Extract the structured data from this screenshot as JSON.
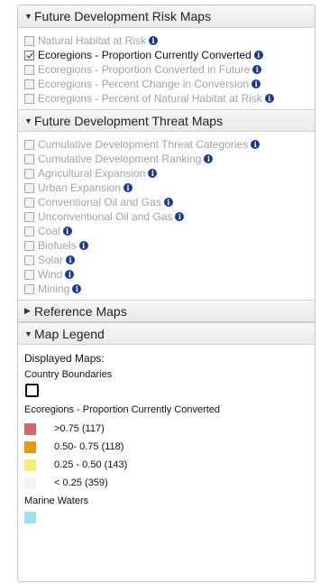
{
  "sections": {
    "risk": {
      "title": "Future Development Risk Maps",
      "items": [
        {
          "label": "Natural Habitat at Risk",
          "checked": false,
          "active": false,
          "info": true
        },
        {
          "label": "Ecoregions - Proportion Currently Converted",
          "checked": true,
          "active": true,
          "info": true
        },
        {
          "label": "Ecoregions - Proportion Converted in Future",
          "checked": false,
          "active": false,
          "info": true
        },
        {
          "label": "Ecoregions - Percent Change in Conversion",
          "checked": false,
          "active": false,
          "info": true
        },
        {
          "label": "Ecoregions - Percent of Natural Habitat at Risk",
          "checked": false,
          "active": false,
          "info": true
        }
      ]
    },
    "threat": {
      "title": "Future Development Threat Maps",
      "items": [
        {
          "label": "Cumulative Development Threat Categories",
          "checked": false,
          "active": false,
          "info": true
        },
        {
          "label": "Cumulative Development Ranking",
          "checked": false,
          "active": false,
          "info": true
        },
        {
          "label": "Agricultural Expansion",
          "checked": false,
          "active": false,
          "info": true
        },
        {
          "label": "Urban Expansion",
          "checked": false,
          "active": false,
          "info": true
        },
        {
          "label": "Conventional Oil and Gas",
          "checked": false,
          "active": false,
          "info": true
        },
        {
          "label": "Unconventional Oil and Gas",
          "checked": false,
          "active": false,
          "info": true
        },
        {
          "label": "Coal",
          "checked": false,
          "active": false,
          "info": true
        },
        {
          "label": "Biofuels",
          "checked": false,
          "active": false,
          "info": true
        },
        {
          "label": "Solar",
          "checked": false,
          "active": false,
          "info": true
        },
        {
          "label": "Wind",
          "checked": false,
          "active": false,
          "info": true
        },
        {
          "label": "Mining",
          "checked": false,
          "active": false,
          "info": true
        }
      ]
    },
    "reference": {
      "title": "Reference Maps"
    },
    "legend": {
      "title": "Map Legend"
    }
  },
  "legend": {
    "displayed_label": "Displayed Maps:",
    "country_boundaries": "Country Boundaries",
    "ecoregions_title": "Ecoregions - Proportion Currently Converted",
    "classes": [
      {
        "label": ">0.75 (117)",
        "color": "#d9656b"
      },
      {
        "label": "0.50- 0.75 (118)",
        "color": "#e59a0f"
      },
      {
        "label": "0.25 - 0.50 (143)",
        "color": "#f3f07a"
      },
      {
        "label": "< 0.25 (359)",
        "color": "#f4f4f6"
      }
    ],
    "marine_waters": "Marine Waters",
    "marine_color": "#9fe0ee"
  },
  "icons": {
    "info": "info-icon",
    "caret_down": "caret-down-icon",
    "caret_right": "caret-right-icon"
  }
}
